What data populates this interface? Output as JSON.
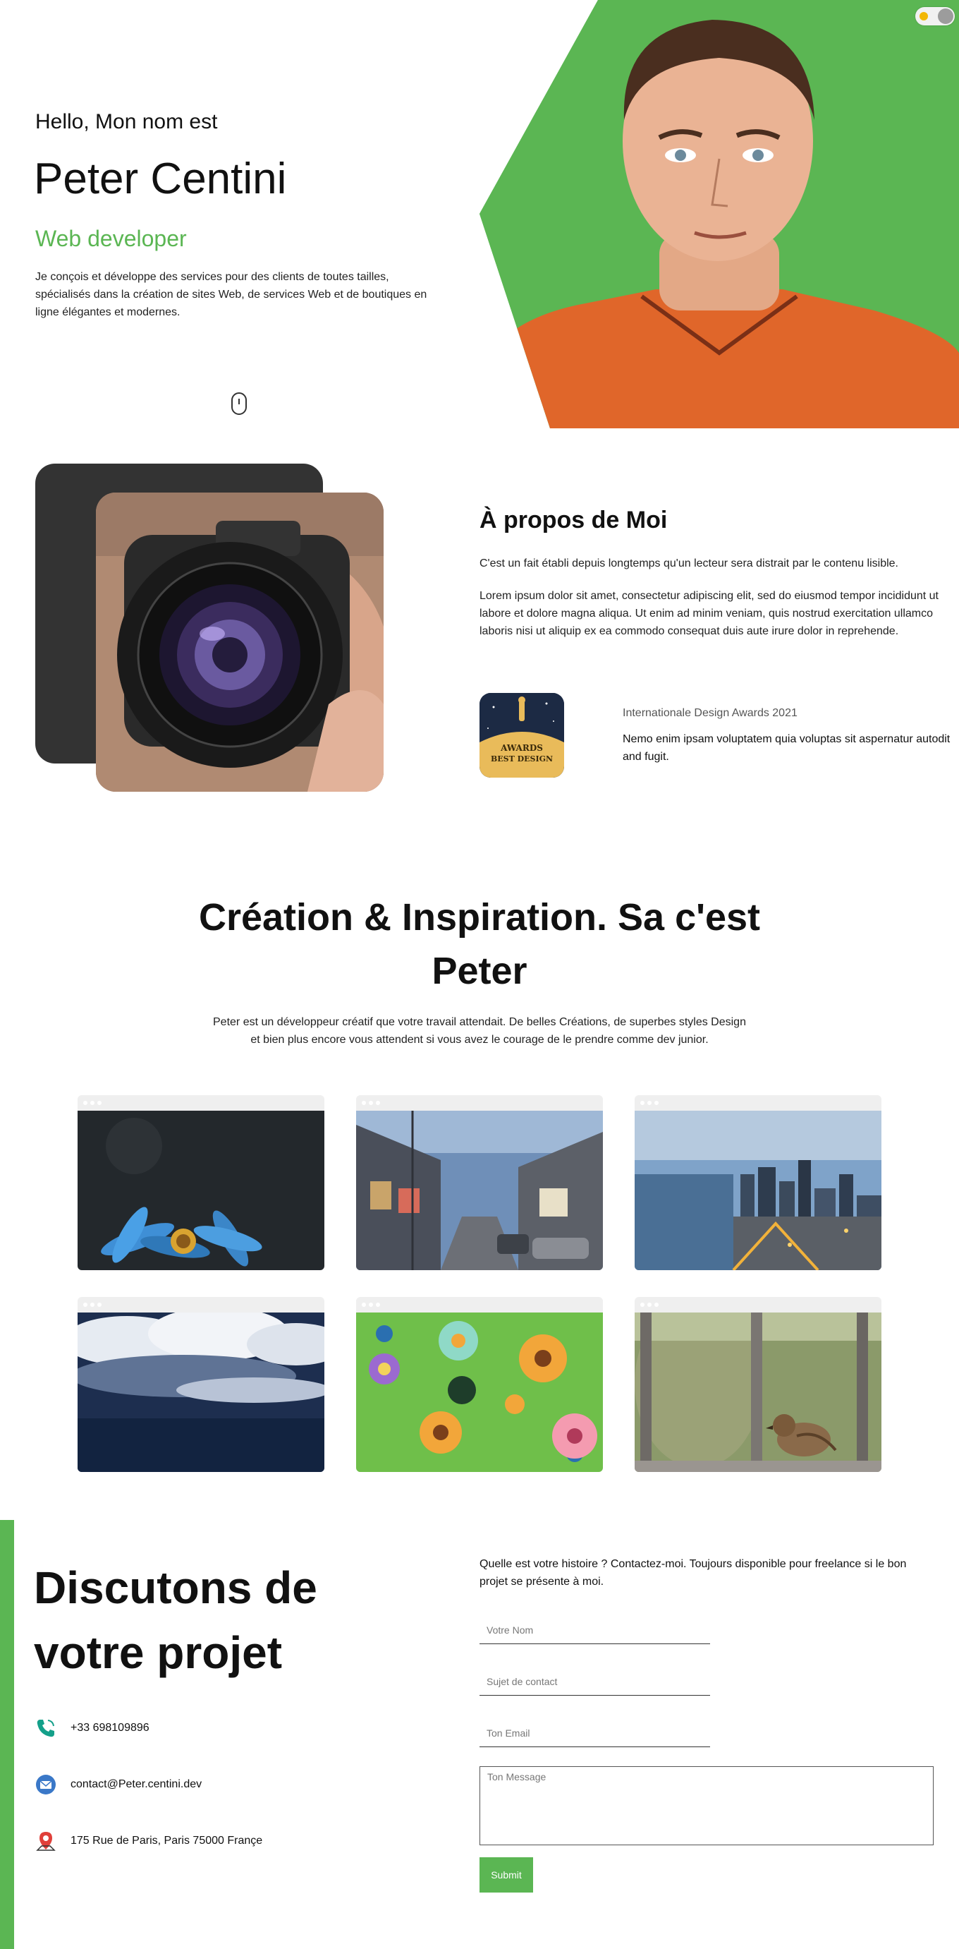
{
  "hero": {
    "greeting": "Hello, Mon nom est",
    "name": "Peter Centini",
    "role": "Web developer",
    "intro": "Je conçois et développe des services pour des clients de toutes tailles, spécialisés dans la création de sites Web, de services Web et de boutiques en ligne élégantes et modernes.",
    "accent_color": "#5bb653"
  },
  "theme_toggle": {
    "icon": "sun-icon"
  },
  "about": {
    "title": "À propos de Moi",
    "paragraph1": "C'est un fait établi depuis longtemps qu'un lecteur sera distrait par le contenu lisible.",
    "paragraph2": "Lorem ipsum dolor sit amet, consectetur adipiscing elit, sed do eiusmod tempor incididunt ut labore et dolore magna aliqua. Ut enim ad minim veniam, quis nostrud exercitation ullamco laboris nisi ut aliquip ex ea commodo consequat duis aute irure dolor in reprehende.",
    "award": {
      "badge_line1": "AWARDS",
      "badge_line2": "BEST DESIGN",
      "name": "Internationale Design Awards 2021",
      "description": "Nemo enim ipsam voluptatem quia voluptas sit aspernatur autodit and fugit."
    }
  },
  "creation": {
    "title": "Création & Inspiration. Sa c'est Peter",
    "text": "Peter est un développeur créatif que votre travail attendait. De belles Créations, de superbes styles Design et bien plus encore vous attendent si vous avez le courage de le prendre comme dev junior.",
    "gallery": [
      "blue flower",
      "street",
      "city skyline",
      "stormy clouds",
      "floral pattern",
      "sparrow"
    ]
  },
  "contact": {
    "title": "Discutons de votre projet",
    "phone": "+33 698109896",
    "email": "contact@Peter.centini.dev",
    "address": "175 Rue de Paris, Paris 75000 Françe",
    "form_intro": "Quelle est votre histoire ? Contactez-moi. Toujours disponible pour freelance si le bon projet se présente à moi.",
    "name_placeholder": "Votre Nom",
    "subject_placeholder": "Sujet de contact",
    "email_placeholder": "Ton Email",
    "message_placeholder": "Ton Message",
    "submit_label": "Submit"
  }
}
